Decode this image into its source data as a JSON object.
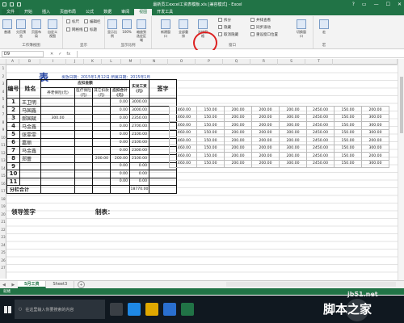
{
  "window": {
    "title": "最新员工excel工资表模板.xls [兼容模式] - Excel",
    "controls": [
      "?",
      "▭",
      "—",
      "☐",
      "✕"
    ]
  },
  "ribbon_tabs": [
    "文件",
    "开始",
    "插入",
    "页面布局",
    "公式",
    "数据",
    "审阅",
    "视图",
    "开发工具"
  ],
  "ribbon": {
    "views": [
      "普通",
      "分页预览",
      "页面布局",
      "自定义视图"
    ],
    "views_group": "工作簿视图",
    "show": [
      "标尺",
      "编辑栏",
      "网格线",
      "标题"
    ],
    "show_group": "显示",
    "zoom": [
      "显示比例",
      "100%",
      "缩放到选定区域"
    ],
    "zoom_group": "显示比例",
    "window_btns": [
      "新建窗口",
      "全部重排",
      "冻结窗格"
    ],
    "window_small": [
      "拆分",
      "隐藏",
      "取消隐藏"
    ],
    "window_small2": [
      "并排查看",
      "同步滚动",
      "重设窗口位置"
    ],
    "window_switch": "切换窗口",
    "window_group": "窗口",
    "macro": "宏",
    "macro_group": "宏"
  },
  "formula_bar": {
    "name_box": "D9",
    "fx": "fx",
    "value": ""
  },
  "columns": [
    "A",
    "B",
    "C",
    "D",
    "E",
    "F",
    "G",
    "H",
    "I",
    "J",
    "K",
    "L",
    "M",
    "N",
    "O",
    "P",
    "Q",
    "R",
    "S",
    "T"
  ],
  "rows": [
    "1",
    "2",
    "3",
    "4",
    "5",
    "6",
    "7",
    "8",
    "9",
    "10",
    "11",
    "12",
    "13",
    "14",
    "15",
    "16",
    "17",
    "18",
    "19",
    "20",
    "21",
    "22",
    "23",
    "24",
    "25",
    "26",
    "27"
  ],
  "sheet": {
    "title": "表",
    "subtitle": "发放日期：2015年1月12日  所属日期：2015年1月",
    "header_group": "应扣金额",
    "h_no": "编号",
    "h_name": "姓名",
    "h_pension": "养老保险(元)",
    "h_medical": "医疗保险(元)",
    "h_other": "其它扣款(元)",
    "h_total": "应扣合计(元)",
    "h_actual": "实发工资(元)",
    "h_sign": "签字",
    "rows": [
      {
        "no": "1",
        "name": "王卫明",
        "pension": "",
        "medical": "",
        "other": "",
        "total": "0.00",
        "actual": "3000.00"
      },
      {
        "no": "2",
        "name": "马国鑫",
        "pension": "",
        "medical": "",
        "other": "",
        "total": "0.00",
        "actual": "3000.00"
      },
      {
        "no": "3",
        "name": "郝国斌",
        "pension": "300.00",
        "medical": "",
        "other": "",
        "total": "0.00",
        "actual": "2350.00"
      },
      {
        "no": "4",
        "name": "马金鑫",
        "pension": "",
        "medical": "",
        "other": "",
        "total": "0.00",
        "actual": "2700.00"
      },
      {
        "no": "5",
        "name": "张雯雯",
        "pension": "",
        "medical": "",
        "other": "",
        "total": "0.00",
        "actual": "2100.00"
      },
      {
        "no": "6",
        "name": "嘉丽",
        "pension": "",
        "medical": "",
        "other": "",
        "total": "0.00",
        "actual": "2100.00"
      },
      {
        "no": "7",
        "name": "马金鑫",
        "pension": "",
        "medical": "",
        "other": "",
        "total": "0.00",
        "actual": "2300.00"
      },
      {
        "no": "8",
        "name": "郑蕾",
        "pension": "",
        "medical": "",
        "other": "200.00",
        "total": "200.00",
        "actual": "2100.00"
      },
      {
        "no": "9",
        "name": "",
        "pension": "",
        "medical": "",
        "other": "",
        "total": "0.00",
        "actual": "0.00"
      },
      {
        "no": "10",
        "name": "",
        "pension": "",
        "medical": "",
        "other": "",
        "total": "0.00",
        "actual": "0.00"
      },
      {
        "no": "11",
        "name": "",
        "pension": "",
        "medical": "",
        "other": "",
        "total": "0.00",
        "actual": "0.00"
      }
    ],
    "subtotal_label": "分栏合计",
    "subtotal_value": "18770.00",
    "leader_sign": "领导签字",
    "maker": "制表："
  },
  "ext_rows": [
    [
      "1460.00",
      "150.00",
      "200.00",
      "200.00",
      "200.00",
      "2450.00",
      "150.00",
      "200.00"
    ],
    [
      "1460.00",
      "150.00",
      "200.00",
      "200.00",
      "300.00",
      "2450.00",
      "150.00",
      "300.00"
    ],
    [
      "1460.00",
      "150.00",
      "200.00",
      "200.00",
      "300.00",
      "2450.00",
      "150.00",
      "300.00"
    ],
    [
      "1460.00",
      "150.00",
      "200.00",
      "200.00",
      "300.00",
      "2450.00",
      "150.00",
      "300.00"
    ],
    [
      "1460.00",
      "150.00",
      "200.00",
      "200.00",
      "200.00",
      "2450.00",
      "150.00",
      "200.00"
    ],
    [
      "1460.00",
      "150.00",
      "200.00",
      "200.00",
      "300.00",
      "2450.00",
      "150.00",
      "300.00"
    ],
    [
      "1460.00",
      "150.00",
      "200.00",
      "200.00",
      "200.00",
      "2450.00",
      "150.00",
      "200.00"
    ],
    [
      "1460.00",
      "150.00",
      "200.00",
      "200.00",
      "300.00",
      "2450.00",
      "150.00",
      "300.00"
    ]
  ],
  "sheet_tabs": [
    "5月工资",
    "Sheet3"
  ],
  "status": "就绪",
  "taskbar": {
    "search_placeholder": "在这里输入你要搜索的内容"
  },
  "watermark": {
    "line1": "jb51.net",
    "line2": "脚本之家"
  }
}
